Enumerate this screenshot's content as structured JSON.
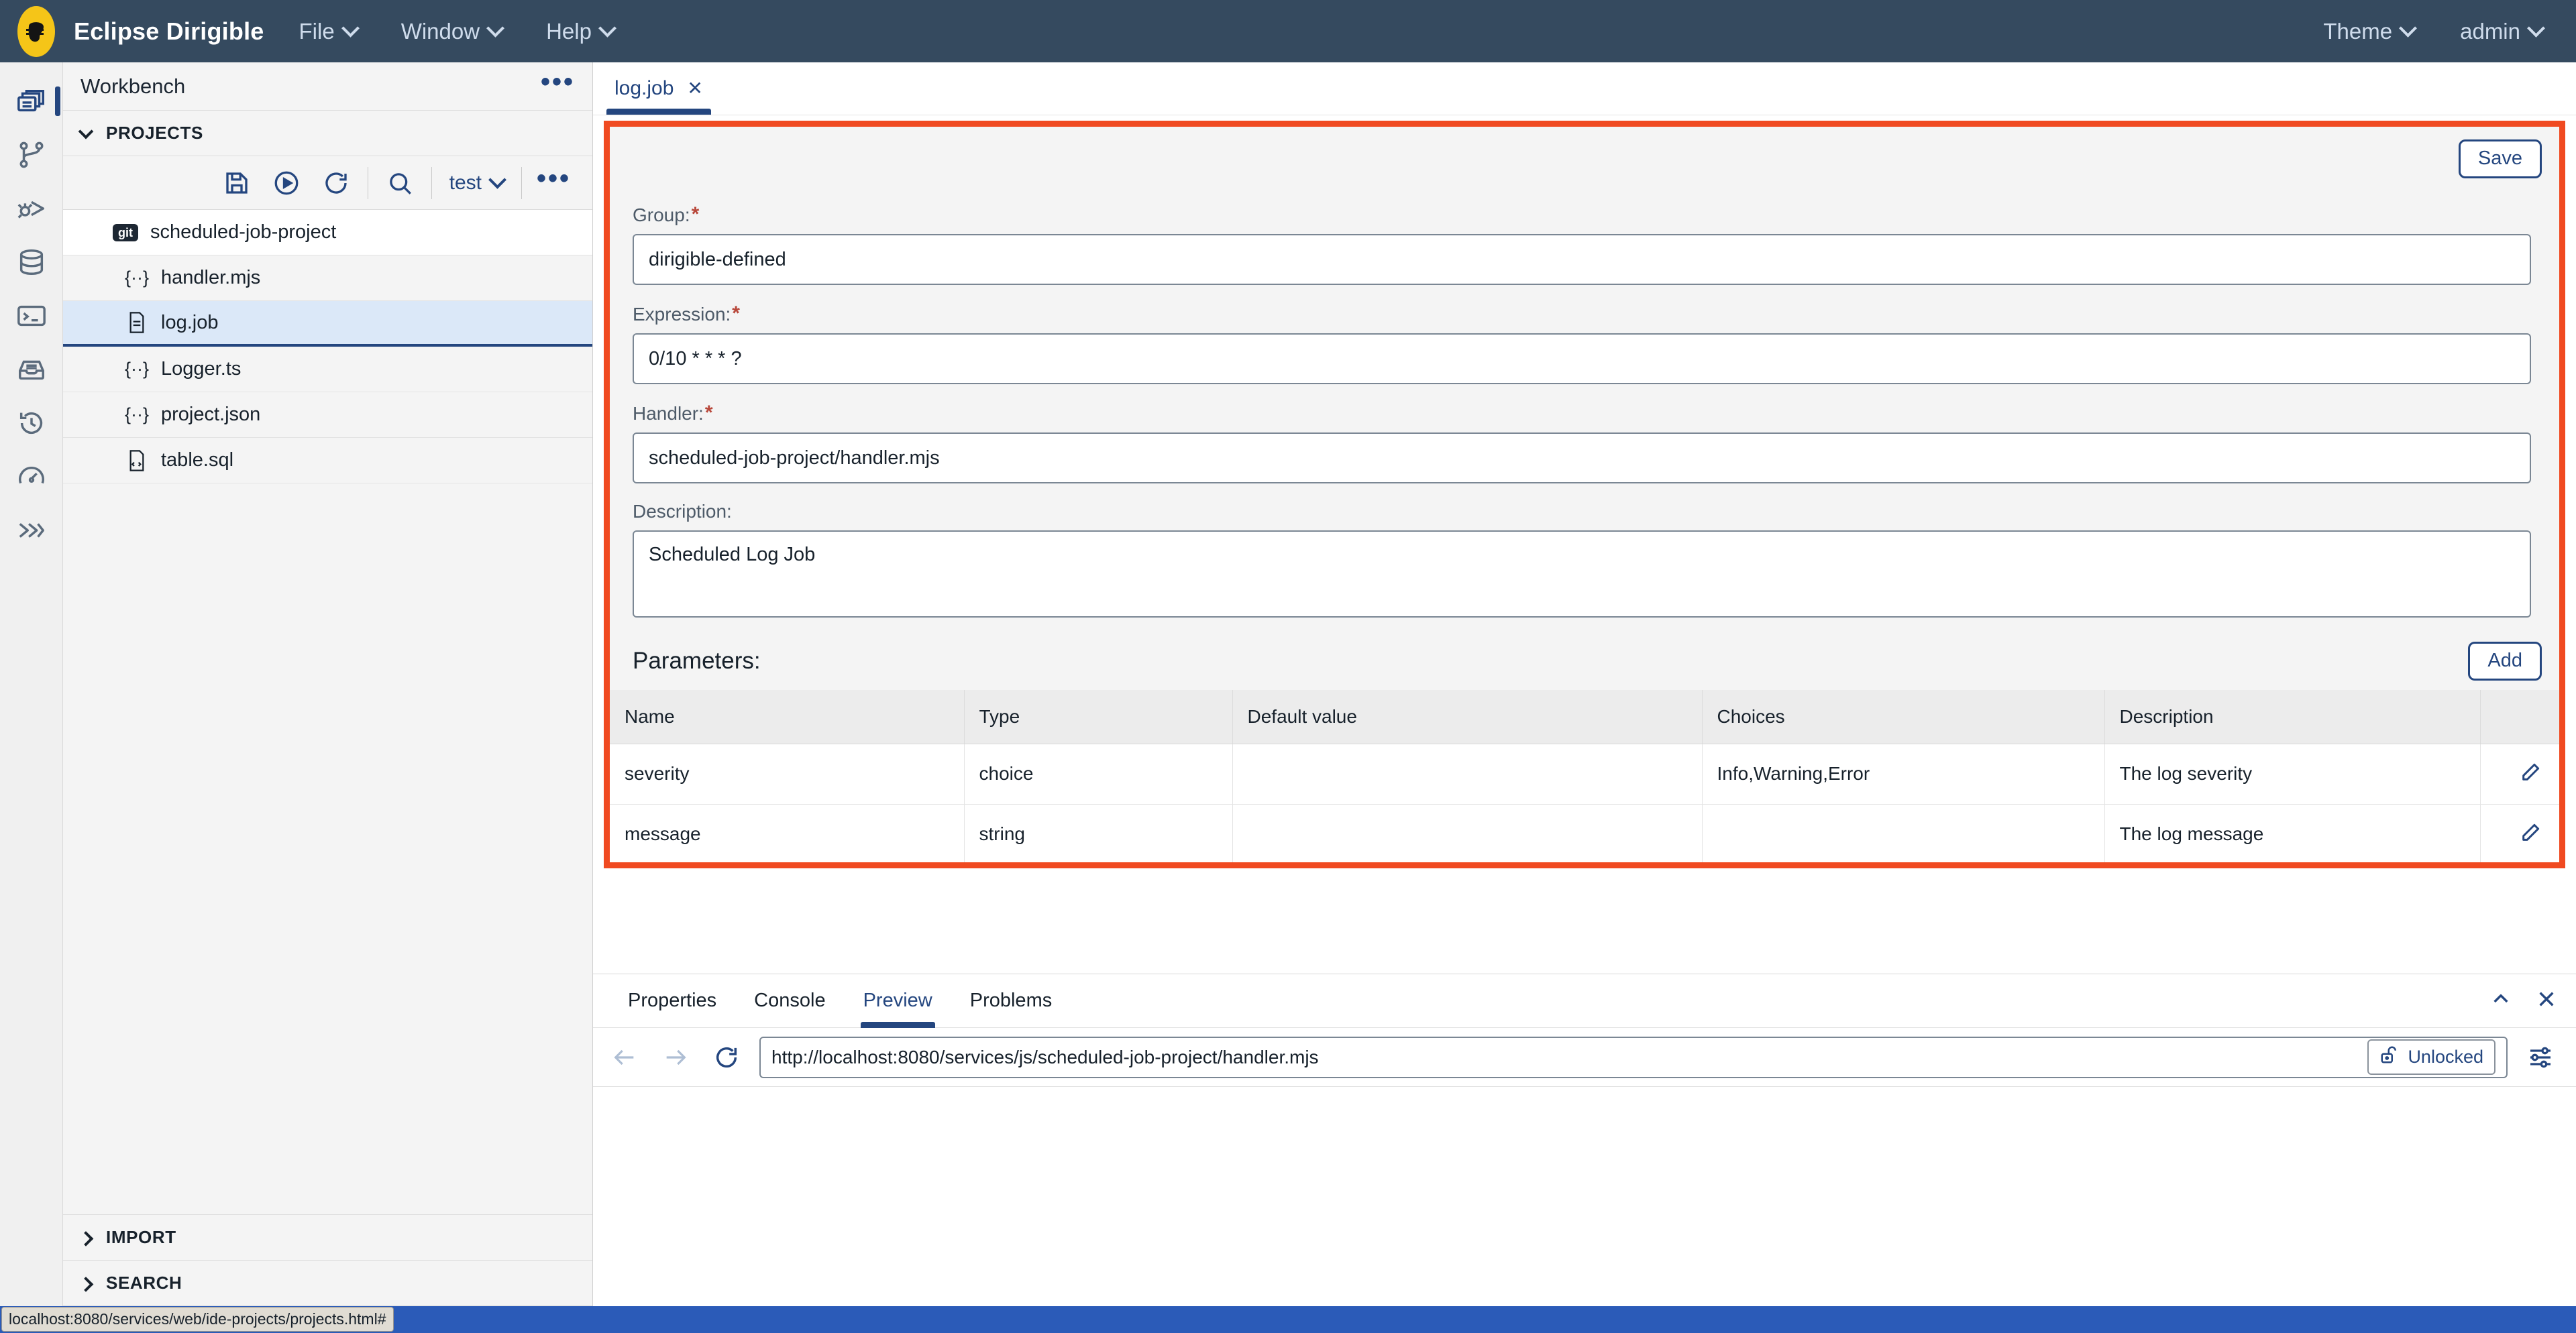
{
  "topbar": {
    "logo_icon": "dirigible-logo-icon",
    "brand": "Eclipse Dirigible",
    "menus": [
      {
        "label": "File",
        "icon": "chevron-down-icon"
      },
      {
        "label": "Window",
        "icon": "chevron-down-icon"
      },
      {
        "label": "Help",
        "icon": "chevron-down-icon"
      }
    ],
    "right_menus": [
      {
        "label": "Theme",
        "icon": "chevron-down-icon"
      },
      {
        "label": "admin",
        "icon": "chevron-down-icon"
      }
    ]
  },
  "activitybar": {
    "items": [
      {
        "name": "projects-icon",
        "active": true
      },
      {
        "name": "git-branch-icon",
        "active": false
      },
      {
        "name": "debugger-icon",
        "active": false
      },
      {
        "name": "database-icon",
        "active": false
      },
      {
        "name": "terminal-icon",
        "active": false
      },
      {
        "name": "repository-icon",
        "active": false
      },
      {
        "name": "history-icon",
        "active": false
      },
      {
        "name": "performance-icon",
        "active": false
      },
      {
        "name": "jobs-icon",
        "active": false
      }
    ]
  },
  "leftpanel": {
    "workbench_title": "Workbench",
    "workbench_more_icon": "more-options-icon",
    "projects_section": {
      "label": "PROJECTS",
      "expanded": true
    },
    "toolbar": {
      "save_icon": "save-icon",
      "run_icon": "run-icon",
      "refresh_icon": "refresh-icon",
      "search_icon": "search-icon",
      "workspace_label": "test",
      "workspace_chevron": "chevron-down-icon",
      "more_icon": "more-options-icon"
    },
    "tree": {
      "root": {
        "label": "scheduled-job-project",
        "badge": "git",
        "expanded": true
      },
      "files": [
        {
          "label": "handler.mjs",
          "icon": "js-file-icon",
          "selected": false
        },
        {
          "label": "log.job",
          "icon": "job-file-icon",
          "selected": true
        },
        {
          "label": "Logger.ts",
          "icon": "js-file-icon",
          "selected": false
        },
        {
          "label": "project.json",
          "icon": "js-file-icon",
          "selected": false
        },
        {
          "label": "table.sql",
          "icon": "sql-file-icon",
          "selected": false
        }
      ]
    },
    "import_section": {
      "label": "IMPORT",
      "expanded": false
    },
    "search_section": {
      "label": "SEARCH",
      "expanded": false
    }
  },
  "editor": {
    "tabs": [
      {
        "label": "log.job",
        "close_icon": "close-icon",
        "active": true
      }
    ],
    "save_label": "Save",
    "form": {
      "group": {
        "label": "Group:",
        "required": true,
        "value": "dirigible-defined"
      },
      "expression": {
        "label": "Expression:",
        "required": true,
        "value": "0/10 * * * ?"
      },
      "handler": {
        "label": "Handler:",
        "required": true,
        "value": "scheduled-job-project/handler.mjs"
      },
      "description": {
        "label": "Description:",
        "required": false,
        "value": "Scheduled Log Job"
      }
    },
    "parameters": {
      "title": "Parameters:",
      "add_label": "Add",
      "columns": [
        "Name",
        "Type",
        "Default value",
        "Choices",
        "Description",
        ""
      ],
      "rows": [
        {
          "name": "severity",
          "type": "choice",
          "default_value": "",
          "choices": "Info,Warning,Error",
          "description": "The log severity",
          "edit_icon": "edit-icon",
          "delete_icon": "delete-icon"
        },
        {
          "name": "message",
          "type": "string",
          "default_value": "",
          "choices": "",
          "description": "The log message",
          "edit_icon": "edit-icon",
          "delete_icon": "delete-icon"
        }
      ]
    }
  },
  "bottompanel": {
    "tabs": [
      {
        "label": "Properties",
        "active": false
      },
      {
        "label": "Console",
        "active": false
      },
      {
        "label": "Preview",
        "active": true
      },
      {
        "label": "Problems",
        "active": false
      }
    ],
    "collapse_icon": "chevron-up-icon",
    "close_icon": "close-icon",
    "preview": {
      "back_icon": "arrow-left-icon",
      "forward_icon": "arrow-right-icon",
      "reload_icon": "reload-icon",
      "url": "http://localhost:8080/services/js/scheduled-job-project/handler.mjs",
      "lock_label": "Unlocked",
      "lock_icon": "unlock-icon",
      "settings_icon": "sliders-icon"
    }
  },
  "statusbar": {
    "tooltip": "localhost:8080/services/web/ide-projects/projects.html#"
  },
  "colors": {
    "header_bg": "#354a5f",
    "accent_blue": "#24467f",
    "highlight_red": "#f04a21",
    "selected_row": "#dbe8f8",
    "status_bar": "#2b5bb8",
    "required_mark": "#b8473a",
    "logo_yellow": "#f5c518"
  }
}
